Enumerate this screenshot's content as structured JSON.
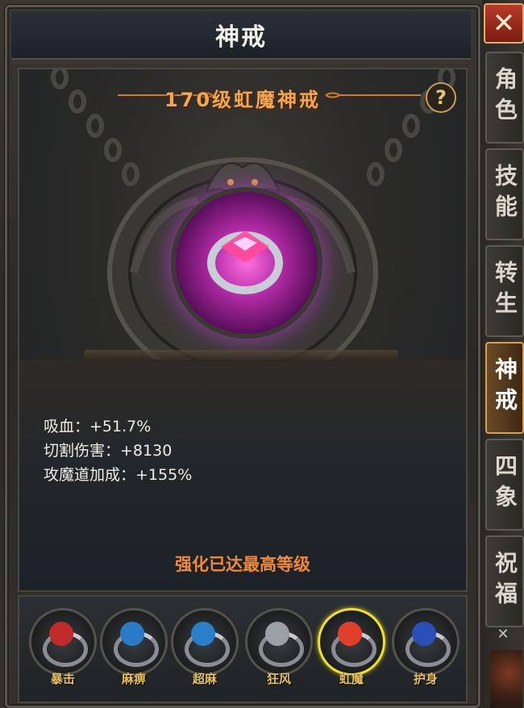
{
  "window": {
    "title": "神戒"
  },
  "ring": {
    "title": "170级虹魔神戒",
    "help_icon": "?",
    "stats": [
      {
        "label": "吸血：",
        "value": "+51.7%"
      },
      {
        "label": "切割伤害：",
        "value": "+8130"
      },
      {
        "label": "攻魔道加成：",
        "value": "+155%"
      }
    ],
    "status": "强化已达最高等级",
    "accent_color": "#f0a850"
  },
  "ring_slots": [
    {
      "label": "暴击",
      "gem_color": "#c02a2a",
      "active": false
    },
    {
      "label": "麻痹",
      "gem_color": "#2a7ac8",
      "active": false
    },
    {
      "label": "超麻",
      "gem_color": "#2a80c8",
      "active": false
    },
    {
      "label": "狂风",
      "gem_color": "#9aa0a6",
      "active": false
    },
    {
      "label": "虹魔",
      "gem_color": "#e0402a",
      "active": true
    },
    {
      "label": "护身",
      "gem_color": "#2a50b8",
      "active": false
    }
  ],
  "side_tabs": [
    {
      "label": "角色",
      "active": false
    },
    {
      "label": "技能",
      "active": false
    },
    {
      "label": "转生",
      "active": false
    },
    {
      "label": "神戒",
      "active": true
    },
    {
      "label": "四象",
      "active": false
    },
    {
      "label": "祝福",
      "active": false
    }
  ],
  "close_icon": "✕",
  "side_bottom_icon": "✕"
}
